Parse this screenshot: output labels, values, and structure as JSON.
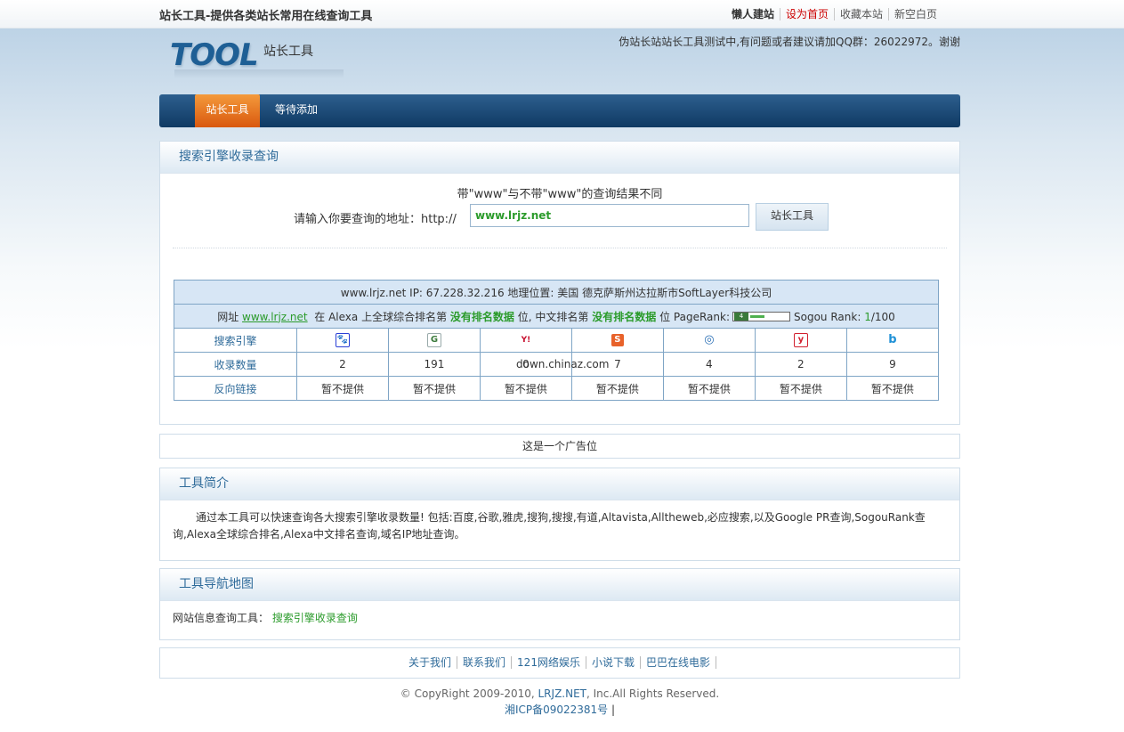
{
  "header": {
    "site_title": "站长工具-提供各类站长常用在线查询工具",
    "top_links": [
      "懒人建站",
      "设为首页",
      "收藏本站",
      "新空白页"
    ],
    "logo_text": "TOOL",
    "logo_sub": "站长工具",
    "notice": "伪站长站站长工具测试中,有问题或者建议请加QQ群：26022972。谢谢"
  },
  "nav": {
    "items": [
      "站长工具",
      "等待添加"
    ]
  },
  "search_panel": {
    "title": "搜索引擎收录查询",
    "hint": "带\"www\"与不带\"www\"的查询结果不同",
    "input_label": "请输入你要查询的地址：http://",
    "input_value": "www.lrjz.net",
    "button_label": "站长工具"
  },
  "result": {
    "info_line": "www.lrjz.net IP: 67.228.32.216 地理位置: 美国 德克萨斯州达拉斯市SoftLayer科技公司",
    "rank": {
      "prefix": "网址",
      "domain": "www.lrjz.net",
      "alexa_text": "在 Alexa 上全球综合排名第",
      "alexa_rank": "没有排名数据",
      "unit1": "位,",
      "cn_text": "中文排名第",
      "cn_rank": "没有排名数据",
      "pagerank_text": "位 PageRank:",
      "pagerank_value": "4",
      "pagerank_fraction": 0.4,
      "sogou_text": "Sogou Rank:",
      "sogou_value": "1",
      "sogou_total": "/100"
    },
    "row_labels": [
      "搜索引擎",
      "收录数量",
      "反向链接"
    ],
    "engines": [
      {
        "icon": "baidu-icon",
        "glyph": "🐾",
        "color": "#2a3fd6",
        "count": "2",
        "backlinks": "暂不提供"
      },
      {
        "icon": "google-icon",
        "glyph": "G",
        "color": "#3b7a3b",
        "count": "191",
        "backlinks": "暂不提供"
      },
      {
        "icon": "yahoo-icon",
        "glyph": "Y!",
        "color": "#c8102e",
        "count": "0",
        "backlinks": "暂不提供"
      },
      {
        "icon": "sogou-icon",
        "glyph": "S",
        "color": "#e8622a",
        "count": "7",
        "backlinks": "暂不提供"
      },
      {
        "icon": "soso-icon",
        "glyph": "◎",
        "color": "#2a6fb5",
        "count": "4",
        "backlinks": "暂不提供"
      },
      {
        "icon": "youdao-icon",
        "glyph": "y",
        "color": "#d2202f",
        "count": "2",
        "backlinks": "暂不提供"
      },
      {
        "icon": "bing-icon",
        "glyph": "b",
        "color": "#1e90d6",
        "count": "9",
        "backlinks": "暂不提供"
      }
    ],
    "watermark": "down.chinaz.com"
  },
  "ad": {
    "text": "这是一个广告位"
  },
  "intro_panel": {
    "title": "工具简介",
    "text": "通过本工具可以快速查询各大搜索引擎收录数量! 包括:百度,谷歌,雅虎,搜狗,搜搜,有道,Altavista,Alltheweb,必应搜索,以及Google PR查询,SogouRank查询,Alexa全球综合排名,Alexa中文排名查询,域名IP地址查询。"
  },
  "map_panel": {
    "title": "工具导航地图",
    "label": "网站信息查询工具：",
    "link": "搜索引擎收录查询"
  },
  "footer": {
    "links": [
      "关于我们",
      "联系我们",
      "121网络娱乐",
      "小说下载",
      "巴巴在线电影"
    ],
    "copyright_prefix": "© CopyRight 2009-2010,",
    "copyright_brand": "LRJZ.NET",
    "copyright_suffix": ", Inc.All Rights Reserved.",
    "icp": "湘ICP备09022381号",
    "icp_sep": "|"
  }
}
